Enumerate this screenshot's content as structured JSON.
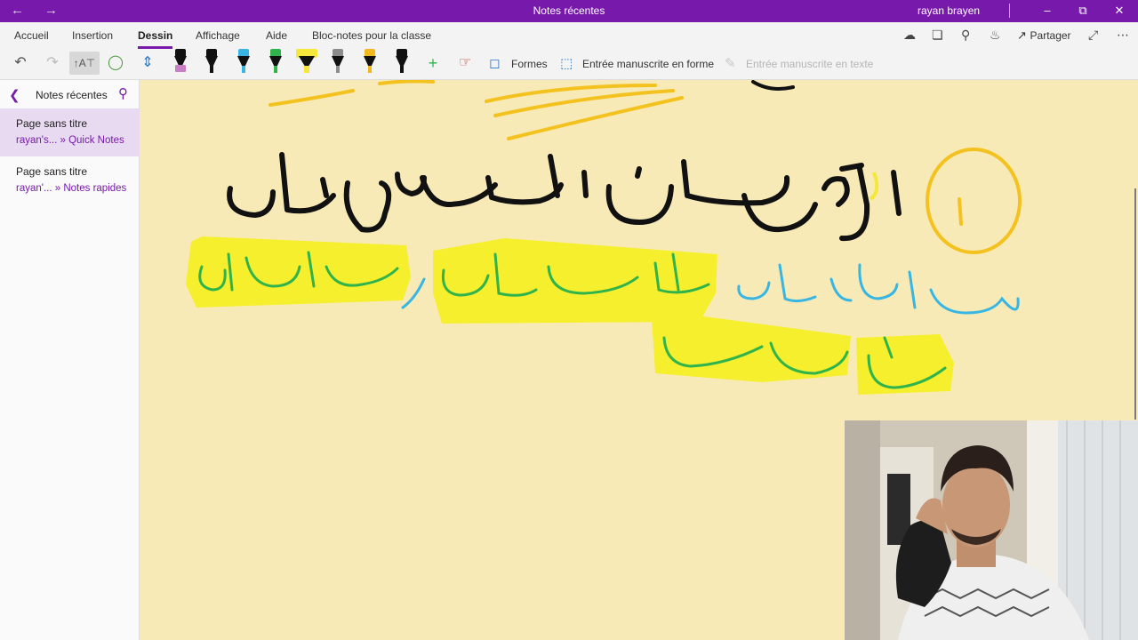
{
  "titlebar": {
    "back_icon": "arrow-left-icon",
    "forward_icon": "arrow-right-icon",
    "title": "Notes récentes",
    "user": "rayan brayen",
    "minimize_icon": "minimize-icon",
    "restore_icon": "restore-icon",
    "close_icon": "close-icon"
  },
  "ribbon": {
    "tabs": [
      "Accueil",
      "Insertion",
      "Dessin",
      "Affichage",
      "Aide",
      "Bloc-notes pour la classe"
    ],
    "active_tab": "Dessin",
    "share_label": "Partager",
    "shapes_label": "Formes",
    "ink_to_shape_label": "Entrée manuscrite en forme",
    "ink_to_text_label": "Entrée manuscrite en texte",
    "pen_colors": [
      "#c77fc3",
      "#111111",
      "#37b6e3",
      "#2fb34a",
      "#f5e83a",
      "#8c8c8c",
      "#f3b81f",
      "#111111"
    ],
    "accent_color": "#7719aa"
  },
  "sidebar": {
    "title": "Notes récentes",
    "items": [
      {
        "title": "Page sans titre",
        "path": "rayan's... » Quick Notes"
      },
      {
        "title": "Page sans titre",
        "path": "rayan'... » Notes rapides"
      }
    ]
  }
}
